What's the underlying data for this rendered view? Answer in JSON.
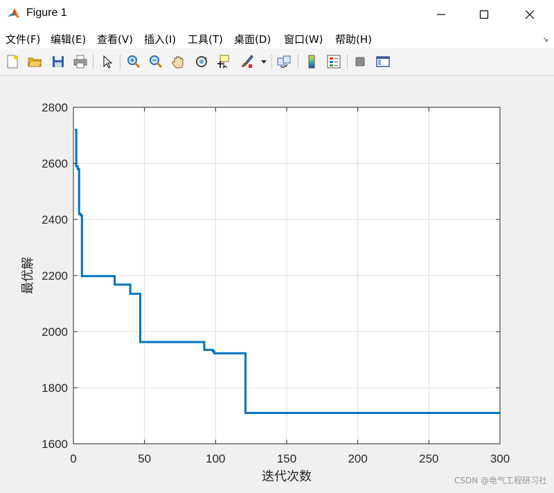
{
  "window": {
    "title": "Figure 1"
  },
  "menu": {
    "items": [
      {
        "label": "文件(F)"
      },
      {
        "label": "编辑(E)"
      },
      {
        "label": "查看(V)"
      },
      {
        "label": "插入(I)"
      },
      {
        "label": "工具(T)"
      },
      {
        "label": "桌面(D)"
      },
      {
        "label": "窗口(W)"
      },
      {
        "label": "帮助(H)"
      }
    ]
  },
  "toolbar": {
    "icons": [
      "new-figure-icon",
      "open-file-icon",
      "save-icon",
      "print-icon",
      "pointer-icon",
      "zoom-in-icon",
      "zoom-out-icon",
      "pan-hand-icon",
      "rotate-3d-icon",
      "data-cursor-icon",
      "brush-icon",
      "link-plot-icon",
      "colorbar-icon",
      "legend-icon",
      "hide-plot-tools-icon",
      "show-plot-tools-icon"
    ]
  },
  "chart_data": {
    "type": "line",
    "title": "",
    "xlabel": "迭代次数",
    "ylabel": "最优解",
    "xlim": [
      0,
      300
    ],
    "ylim": [
      1600,
      2800
    ],
    "xticks": [
      0,
      50,
      100,
      150,
      200,
      250,
      300
    ],
    "yticks": [
      1600,
      1800,
      2000,
      2200,
      2400,
      2600,
      2800
    ],
    "grid": true,
    "series": [
      {
        "color": "#0072bd",
        "x": [
          1,
          2,
          2,
          3,
          3,
          4,
          4,
          5,
          5,
          6,
          6,
          29,
          29,
          39,
          39,
          40,
          40,
          46,
          46,
          47,
          47,
          92,
          92,
          98,
          98,
          99,
          99,
          120,
          120,
          121,
          121,
          300
        ],
        "y": [
          2720,
          2720,
          2590,
          2590,
          2580,
          2580,
          2420,
          2420,
          2415,
          2415,
          2198,
          2198,
          2168,
          2168,
          2168,
          2168,
          2135,
          2135,
          2135,
          2135,
          1963,
          1963,
          1935,
          1935,
          1930,
          1930,
          1923,
          1923,
          1923,
          1923,
          1710,
          1710
        ]
      }
    ]
  },
  "watermark": "CSDN @电气工程研习社"
}
